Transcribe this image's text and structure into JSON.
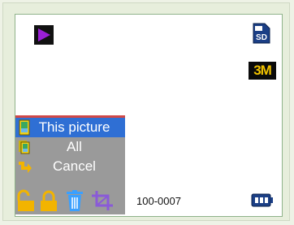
{
  "screen": {
    "menu": {
      "items": [
        {
          "label": "This picture",
          "selected": true
        },
        {
          "label": "All",
          "selected": false
        },
        {
          "label": "Cancel",
          "selected": false
        }
      ],
      "tools": [
        {
          "icon": "unlock-icon"
        },
        {
          "icon": "lock-icon"
        },
        {
          "icon": "trash-icon"
        },
        {
          "icon": "crop-icon"
        }
      ]
    },
    "indicators": {
      "mode_icon": "play-icon",
      "storage_icon": "sd-card-icon",
      "storage_label": "SD",
      "resolution": "3M",
      "file_number": "100-0007",
      "battery_icon": "battery-icon"
    }
  },
  "colors": {
    "selection": "#2f6fd4",
    "menu_background": "#9a9a9a",
    "play_icon": "#9b1fd6",
    "resolution_text": "#f2c300",
    "accent_yellow": "#f2b400",
    "trash_blue": "#3aa0ff",
    "crop_purple": "#8a5ad8"
  }
}
